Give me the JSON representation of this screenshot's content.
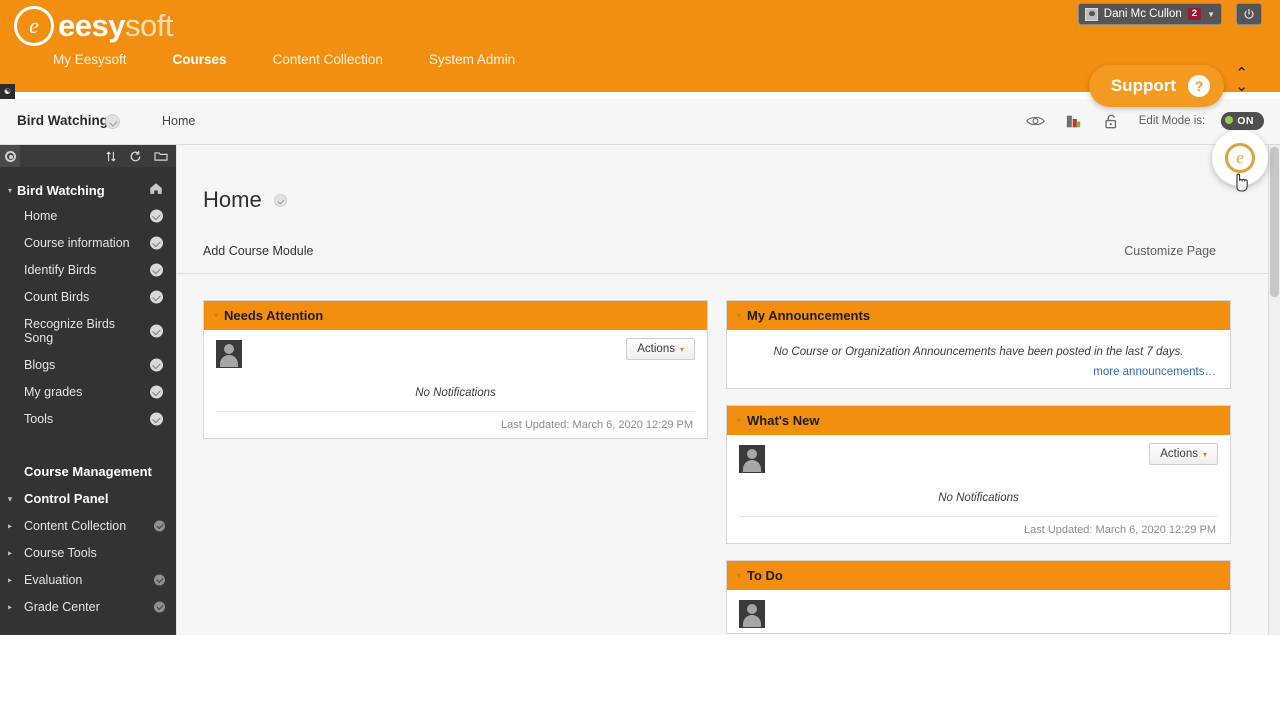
{
  "brand": {
    "logo_mark": "e",
    "logo_name_bold": "eesy",
    "logo_name_light": "soft",
    "accent_orange": "#F28F10",
    "dark_panel": "#333333",
    "badge_red": "#9B1B30",
    "link_blue": "#2D6CA8"
  },
  "topnav": {
    "items": [
      {
        "label": "My Eesysoft",
        "active": false
      },
      {
        "label": "Courses",
        "active": true
      },
      {
        "label": "Content Collection",
        "active": false
      },
      {
        "label": "System Admin",
        "active": false
      }
    ]
  },
  "user_menu": {
    "name": "Dani Mc Cullon",
    "badge_count": "2",
    "caret": "▼",
    "avatar_icon": "user-avatar-icon",
    "power_icon": "power-icon"
  },
  "breadcrumb": {
    "course": "Bird Watching",
    "course_chip_icon": "chevron-down-circle-icon",
    "current": "Home",
    "tools": [
      {
        "name": "student-preview-icon"
      },
      {
        "name": "accessibility-report-icon"
      },
      {
        "name": "unlock-icon"
      }
    ],
    "edit_mode_label": "Edit Mode is:",
    "edit_mode_state": "ON"
  },
  "course_menu": {
    "toolbar": {
      "gear_icon": "gear-icon",
      "icons": [
        {
          "name": "reorder-icon"
        },
        {
          "name": "refresh-icon"
        },
        {
          "name": "folder-icon"
        }
      ]
    },
    "header": {
      "label": "Bird Watching",
      "home_icon": "home-icon",
      "expand_caret": "▾"
    },
    "items": [
      {
        "label": "Home"
      },
      {
        "label": "Course information"
      },
      {
        "label": "Identify Birds"
      },
      {
        "label": "Count Birds"
      },
      {
        "label": "Recognize Birds Song"
      },
      {
        "label": "Blogs"
      },
      {
        "label": "My grades"
      },
      {
        "label": "Tools"
      }
    ],
    "management_title": "Course Management",
    "control_panel": "Control Panel",
    "control_items": [
      {
        "label": "Content Collection"
      },
      {
        "label": "Course Tools"
      },
      {
        "label": "Evaluation"
      },
      {
        "label": "Grade Center"
      }
    ]
  },
  "main": {
    "page_title": "Home",
    "page_title_chip_icon": "chevron-down-circle-icon",
    "add_course_module": "Add Course Module",
    "customize_page": "Customize Page"
  },
  "modules": {
    "left": [
      {
        "title": "Needs Attention",
        "has_actions": true,
        "actions_label": "Actions",
        "actions_caret": "▾",
        "empty_text": "No Notifications",
        "footer": "Last Updated: March 6, 2020 12:29 PM",
        "avatar_icon": "user-thumbnail-icon"
      }
    ],
    "right": [
      {
        "title": "My Announcements",
        "has_actions": false,
        "body_text": "No Course or Organization Announcements have been posted in the last 7 days.",
        "more_link": "more announcements…"
      },
      {
        "title": "What's New",
        "has_actions": true,
        "actions_label": "Actions",
        "actions_caret": "▾",
        "empty_text": "No Notifications",
        "footer": "Last Updated: March 6, 2020 12:29 PM",
        "avatar_icon": "user-thumbnail-icon"
      },
      {
        "title": "To Do",
        "has_actions": false,
        "avatar_icon": "user-thumbnail-icon"
      }
    ]
  },
  "support_widget": {
    "label": "Support",
    "help_glyph": "?",
    "chevron_up": "⌃",
    "chevron_down": "⌄",
    "bubble_glyph": "e",
    "bubble_icon": "eesysoft-launcher-icon"
  }
}
